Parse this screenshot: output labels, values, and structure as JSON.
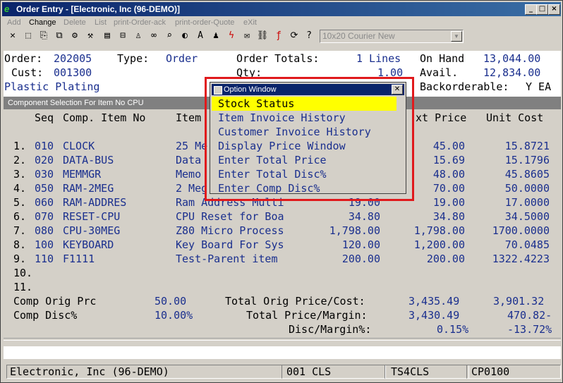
{
  "window": {
    "title": "Order Entry - [Electronic, Inc (96-DEMO)]",
    "min_btn": "_",
    "max_btn": "□",
    "close_btn": "×"
  },
  "menu": {
    "items": [
      {
        "label": "Add",
        "enabled": false
      },
      {
        "label": "Change",
        "enabled": true
      },
      {
        "label": "Delete",
        "enabled": false
      },
      {
        "label": "List",
        "enabled": false
      },
      {
        "label": "print-Order-ack",
        "enabled": false
      },
      {
        "label": "print-order-Quote",
        "enabled": false
      },
      {
        "label": "eXit",
        "enabled": false
      }
    ]
  },
  "toolbar": {
    "icons": [
      "close-icon",
      "select-icon",
      "copy-icon",
      "copy2-icon",
      "gear-icon",
      "settings-icon",
      "list-icon",
      "lock-icon",
      "bell-icon",
      "binoculars-icon",
      "search-icon",
      "globe-icon",
      "font-icon",
      "user-icon",
      "lightning-icon",
      "envelope-icon",
      "link-icon",
      "formula-icon",
      "refresh-icon",
      "doc-icon",
      "help-icon"
    ],
    "font_select": "10x20 Courier New"
  },
  "header": {
    "order_label": "Order:",
    "order_value": "202005",
    "type_label": "Type:",
    "type_value": "Order",
    "cust_label": "Cust:",
    "cust_value": "001300",
    "customer_name": "Plastic Plating",
    "totals_label": "Order Totals:",
    "lines_value": "1 Lines",
    "qty_label": "Qty:",
    "qty_value": "1.00",
    "onhand_label": "On Hand",
    "onhand_value": "13,044.00",
    "avail_label": "Avail.",
    "avail_value": "12,834.00",
    "backorder_label": "Backorderable:",
    "backorder_value": "Y EA"
  },
  "section": {
    "title": "Component Selection For Item No CPU"
  },
  "grid": {
    "headers": {
      "seq": "Seq",
      "comp_item": "Comp. Item No",
      "item": "Item",
      "ext_price": "xt Price",
      "unit_cost": "Unit Cost"
    },
    "rows": [
      {
        "num": "1.",
        "seq": "010",
        "item": "CLOCK",
        "desc": "25 Me",
        "price": "",
        "ext": "45.00",
        "cost": "15.8721"
      },
      {
        "num": "2.",
        "seq": "020",
        "item": "DATA-BUS",
        "desc": "Data",
        "price": "",
        "ext": "15.69",
        "cost": "15.1796"
      },
      {
        "num": "3.",
        "seq": "030",
        "item": "MEMMGR",
        "desc": "Memo",
        "price": "",
        "ext": "48.00",
        "cost": "45.8605"
      },
      {
        "num": "4.",
        "seq": "050",
        "item": "RAM-2MEG",
        "desc": "2 Meg",
        "price": "",
        "ext": "70.00",
        "cost": "50.0000"
      },
      {
        "num": "5.",
        "seq": "060",
        "item": "RAM-ADDRES",
        "desc": "Ram Address Multi",
        "price": "19.00",
        "ext": "19.00",
        "cost": "17.0000"
      },
      {
        "num": "6.",
        "seq": "070",
        "item": "RESET-CPU",
        "desc": "CPU Reset for Boa",
        "price": "34.80",
        "ext": "34.80",
        "cost": "34.5000"
      },
      {
        "num": "7.",
        "seq": "080",
        "item": "CPU-30MEG",
        "desc": "Z80 Micro Process",
        "price": "1,798.00",
        "ext": "1,798.00",
        "cost": "1700.0000"
      },
      {
        "num": "8.",
        "seq": "100",
        "item": "KEYBOARD",
        "desc": "Key Board For Sys",
        "price": "120.00",
        "ext": "1,200.00",
        "cost": "70.0485"
      },
      {
        "num": "9.",
        "seq": "110",
        "item": "F1111",
        "desc": "Test-Parent item",
        "price": "200.00",
        "ext": "200.00",
        "cost": "1322.4223"
      },
      {
        "num": "10.",
        "seq": "",
        "item": "",
        "desc": "",
        "price": "",
        "ext": "",
        "cost": ""
      },
      {
        "num": "11.",
        "seq": "",
        "item": "",
        "desc": "",
        "price": "",
        "ext": "",
        "cost": ""
      }
    ]
  },
  "footer": {
    "comp_orig_prc_label": "Comp Orig Prc",
    "comp_orig_prc_value": "50.00",
    "comp_disc_label": "Comp Disc%",
    "comp_disc_value": "10.00%",
    "total_orig_label": "Total Orig Price/Cost:",
    "total_orig_price": "3,435.49",
    "total_orig_cost": "3,901.32",
    "total_margin_label": "Total Price/Margin:",
    "total_price": "3,430.49",
    "total_margin": "470.82-",
    "disc_margin_label": "Disc/Margin%:",
    "disc_pct": "0.15%",
    "margin_pct": "-13.72%"
  },
  "popup": {
    "title": "Option Window",
    "options": [
      "Stock Status",
      "Item Invoice History",
      "Customer Invoice History",
      "Display Price Window",
      "Enter Total Price",
      "Enter Total Disc%",
      "Enter Comp Disc%"
    ],
    "selected_index": 0
  },
  "status": {
    "company": "Electronic, Inc (96-DEMO)",
    "code1": "001 CLS",
    "code2": "TS4CLS",
    "code3": "CP0100"
  }
}
